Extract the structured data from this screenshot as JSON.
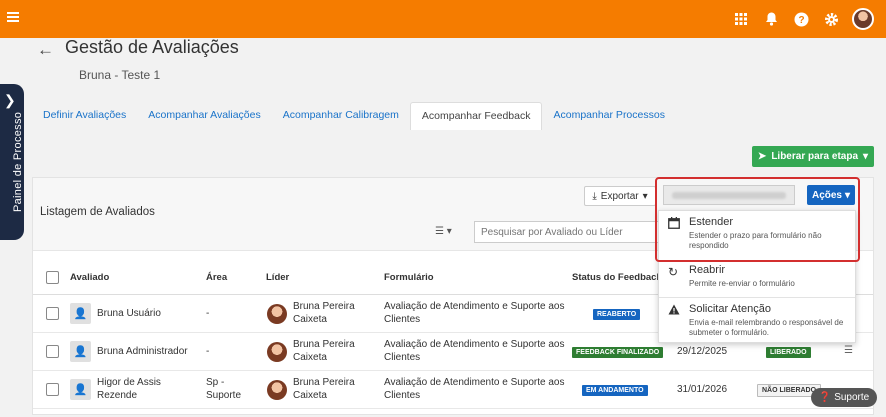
{
  "header": {
    "accent": "#f57c00",
    "icons": [
      "grid-icon",
      "bell-icon",
      "help-icon",
      "gear-icon",
      "avatar"
    ]
  },
  "side_panel": {
    "label": "Painel de Processo"
  },
  "page": {
    "title": "Gestão de Avaliações",
    "subtitle": "Bruna - Teste 1"
  },
  "tabs": [
    {
      "label": "Definir Avaliações"
    },
    {
      "label": "Acompanhar Avaliações"
    },
    {
      "label": "Acompanhar Calibragem"
    },
    {
      "label": "Acompanhar Feedback",
      "active": true
    },
    {
      "label": "Acompanhar Processos"
    }
  ],
  "toolbar": {
    "liberar_label": "Liberar para etapa",
    "export_label": "Exportar",
    "acoes_label": "Ações",
    "search_placeholder": "Pesquisar por Avaliado ou Líder"
  },
  "list": {
    "title": "Listagem de Avaliados",
    "columns": {
      "avaliado": "Avaliado",
      "area": "Área",
      "lider": "Líder",
      "formulario": "Formulário",
      "status": "Status do Feedback"
    },
    "rows": [
      {
        "avaliado": "Bruna Usuário",
        "area": "-",
        "lider": "Bruna Pereira Caixeta",
        "formulario": "Avaliação de Atendimento e Suporte aos Clientes",
        "status": "REABERTO",
        "status_color": "#1565c0",
        "date": "",
        "release": ""
      },
      {
        "avaliado": "Bruna Administrador",
        "area": "-",
        "lider": "Bruna Pereira Caixeta",
        "formulario": "Avaliação de Atendimento e Suporte aos Clientes",
        "status": "FEEDBACK FINALIZADO",
        "status_color": "#2e7d32",
        "date": "29/12/2025",
        "release": "LIBERADO"
      },
      {
        "avaliado": "Higor de Assis Rezende",
        "area": "Sp - Suporte",
        "lider": "Bruna Pereira Caixeta",
        "formulario": "Avaliação de Atendimento e Suporte aos Clientes",
        "status": "EM ANDAMENTO",
        "status_color": "#1565c0",
        "date": "31/01/2026",
        "release": "NÃO LIBERADO"
      }
    ]
  },
  "actions_menu": [
    {
      "title": "Estender",
      "desc": "Estender o prazo para formulário não respondido",
      "icon": "calendar-icon"
    },
    {
      "title": "Reabrir",
      "desc": "Permite re-enviar o formulário",
      "icon": "reopen-icon"
    },
    {
      "title": "Solicitar Atenção",
      "desc": "Envia e-mail relembrando o responsável de submeter o formulário.",
      "icon": "warning-icon"
    }
  ],
  "support": {
    "label": "Suporte"
  }
}
